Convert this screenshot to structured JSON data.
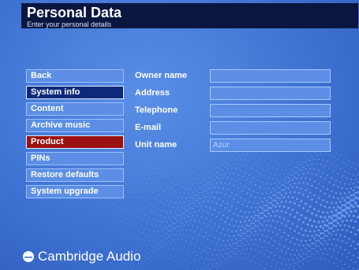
{
  "header": {
    "title": "Personal Data",
    "subtitle": "Enter your personal details"
  },
  "menu": {
    "items": [
      {
        "label": "Back"
      },
      {
        "label": "System info"
      },
      {
        "label": "Content"
      },
      {
        "label": "Archive music"
      },
      {
        "label": "Product"
      },
      {
        "label": "PINs"
      },
      {
        "label": "Restore defaults"
      },
      {
        "label": "System upgrade"
      }
    ],
    "selected": "System info",
    "active": "Product"
  },
  "form": {
    "fields": [
      {
        "label": "Owner name",
        "value": ""
      },
      {
        "label": "Address",
        "value": ""
      },
      {
        "label": "Telephone",
        "value": ""
      },
      {
        "label": "E-mail",
        "value": ""
      },
      {
        "label": "Unit name",
        "value": "Azur"
      }
    ]
  },
  "brand": {
    "name": "Cambridge Audio",
    "icon": "cambridge-audio-logo-icon"
  },
  "colors": {
    "background": "#3f73d3",
    "header": "#0b1640",
    "button": "#5b8ee4",
    "selected": "#0d2a7a",
    "active": "#9b1111"
  }
}
